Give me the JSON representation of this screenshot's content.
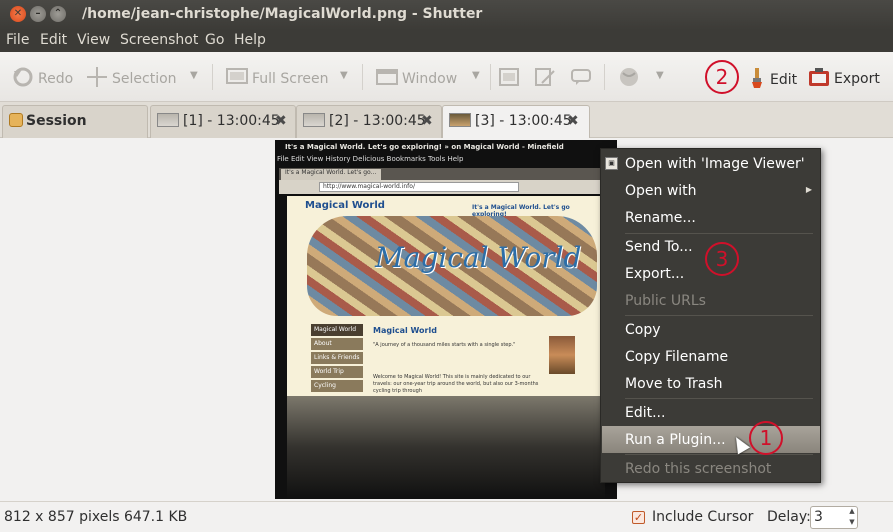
{
  "window": {
    "title": "/home/jean-christophe/MagicalWorld.png - Shutter",
    "close_glyph": "✕",
    "min_glyph": "–",
    "max_glyph": "⌃"
  },
  "menubar": [
    "File",
    "Edit",
    "View",
    "Screenshot",
    "Go",
    "Help"
  ],
  "toolbar": {
    "redo": "Redo",
    "selection": "Selection",
    "full_screen": "Full Screen",
    "window": "Window",
    "edit": "Edit",
    "export": "Export"
  },
  "tabs": [
    {
      "label": "Session"
    },
    {
      "label": "[1] - 13:00:45"
    },
    {
      "label": "[2] - 13:00:45"
    },
    {
      "label": "[3] - 13:00:45"
    }
  ],
  "screenshot": {
    "inner_title": "It's a Magical World. Let's go exploring! » on Magical World - Minefield",
    "inner_menu": "File  Edit  View  History  Delicious  Bookmarks  Tools  Help",
    "inner_tab": "It's a Magical World. Let's go...",
    "inner_url": "http://www.magical-world.info/",
    "site_logo": "Magical World",
    "site_tagline": "It's a Magical World. Let's go exploring!",
    "collage_text": "Magical World",
    "sidebar": [
      "Magical World",
      "About",
      "Links & Friends",
      "World Trip",
      "Cycling"
    ],
    "heading": "Magical World",
    "quote": "\"A journey of a thousand miles starts with a single step.\"",
    "body": "Welcome to Magical World! This site is mainly dedicated to our travels: our one-year trip around the world, but also our 3-months cycling trip through"
  },
  "context_menu": {
    "items": [
      "Open with 'Image Viewer'",
      "Open with",
      "Rename...",
      "Send To...",
      "Export...",
      "Public URLs",
      "Copy",
      "Copy Filename",
      "Move to Trash",
      "Edit...",
      "Run a Plugin...",
      "Redo this screenshot"
    ],
    "submenu_arrow": "▶"
  },
  "annotations": [
    "1",
    "2",
    "3"
  ],
  "statusbar": {
    "info": "812 x 857 pixels  647.1 KB",
    "include_cursor_label": "Include Cursor",
    "include_cursor_checked": true,
    "delay_label": "Delay:",
    "delay_value": "3"
  },
  "colors": {
    "accent_orange": "#d9491c",
    "annotation_red": "#d0102a",
    "dark_panel": "#3c3b37"
  }
}
